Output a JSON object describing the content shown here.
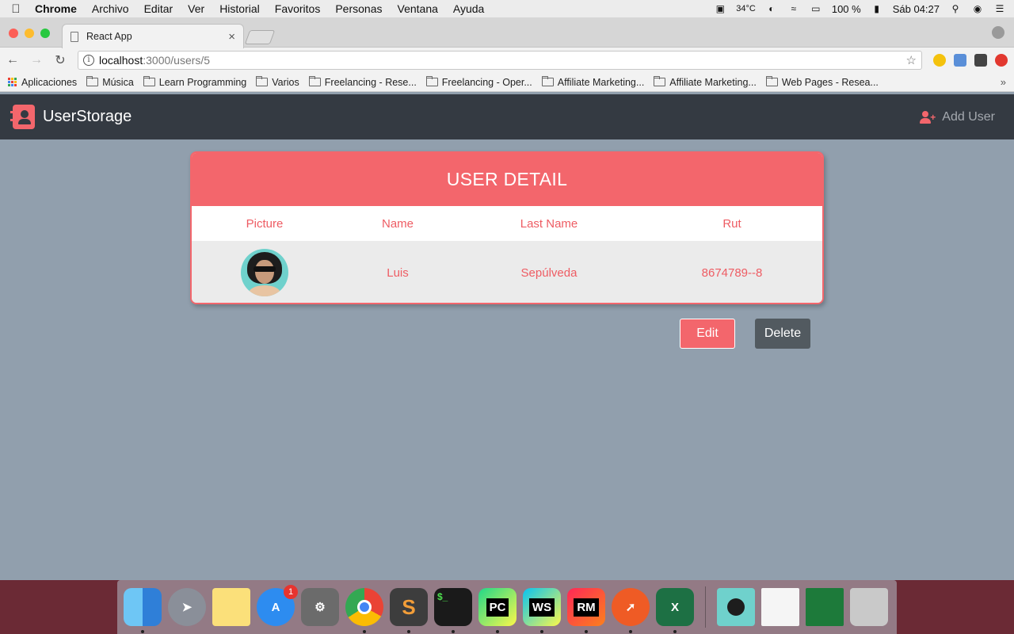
{
  "menubar": {
    "app_name": "Chrome",
    "items": [
      "Archivo",
      "Editar",
      "Ver",
      "Historial",
      "Favoritos",
      "Personas",
      "Ventana",
      "Ayuda"
    ],
    "temperature": "34°C",
    "battery": "100 %",
    "clock": "Sáb 04:27"
  },
  "browser": {
    "tab_title": "React App",
    "tab_close": "×",
    "url_host": "localhost",
    "url_path": ":3000/users/5",
    "bookmarks": [
      {
        "label": "Aplicaciones",
        "icon": "apps-grid-icon"
      },
      {
        "label": "Música",
        "icon": "folder-icon"
      },
      {
        "label": "Learn Programming",
        "icon": "folder-icon"
      },
      {
        "label": "Varios",
        "icon": "folder-icon"
      },
      {
        "label": "Freelancing - Rese...",
        "icon": "folder-icon"
      },
      {
        "label": "Freelancing - Oper...",
        "icon": "folder-icon"
      },
      {
        "label": "Affiliate Marketing...",
        "icon": "folder-icon"
      },
      {
        "label": "Affiliate Marketing...",
        "icon": "folder-icon"
      },
      {
        "label": "Web Pages - Resea...",
        "icon": "folder-icon"
      }
    ],
    "bookmarks_more": "»"
  },
  "app": {
    "brand": "UserStorage",
    "add_user_label": "Add User",
    "card_title": "USER DETAIL",
    "columns": [
      "Picture",
      "Name",
      "Last Name",
      "Rut"
    ],
    "user": {
      "name": "Luis",
      "last_name": "Sepúlveda",
      "rut": "8674789--8"
    },
    "edit_label": "Edit",
    "delete_label": "Delete",
    "colors": {
      "accent": "#f3666c",
      "navbar": "#343a42",
      "background": "#919fad",
      "delete_button": "#525a60"
    }
  },
  "dock": {
    "app_store_badge": "1",
    "pycharm_label": "PC",
    "webstorm_label": "WS",
    "rubymine_label": "RM",
    "excel_label": "X"
  }
}
